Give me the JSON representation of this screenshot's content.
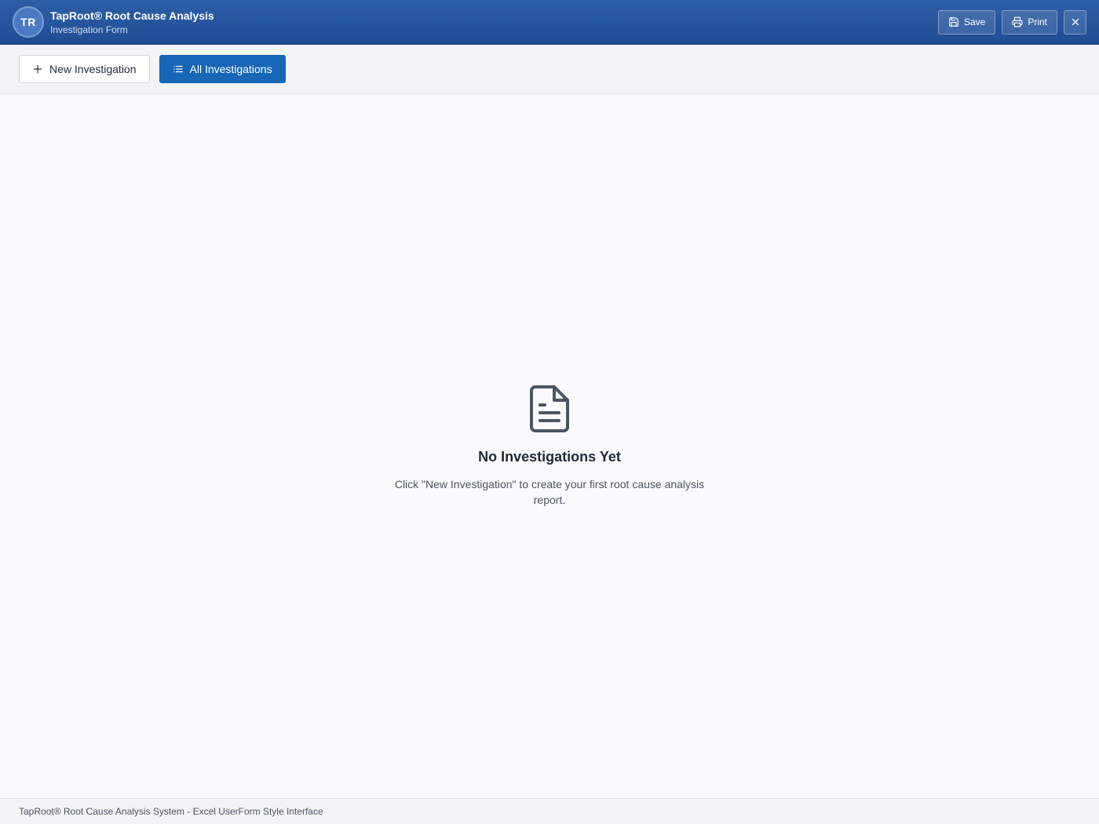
{
  "header": {
    "avatar_initials": "TR",
    "title": "TapRoot® Root Cause Analysis",
    "subtitle": "Investigation Form",
    "save_label": "Save",
    "print_label": "Print",
    "close_icon": "close-icon"
  },
  "toolbar": {
    "new_label": "New Investigation",
    "all_label": "All Investigations"
  },
  "empty_state": {
    "icon": "document-icon",
    "title": "No Investigations Yet",
    "description": "Click \"New Investigation\" to create your first root cause analysis report."
  },
  "footer": {
    "text": "TapRoot® Root Cause Analysis System - Excel UserForm Style Interface"
  },
  "colors": {
    "header_bg": "#2f5ea8",
    "primary": "#1767b8",
    "icon_gray": "#4b5563"
  }
}
